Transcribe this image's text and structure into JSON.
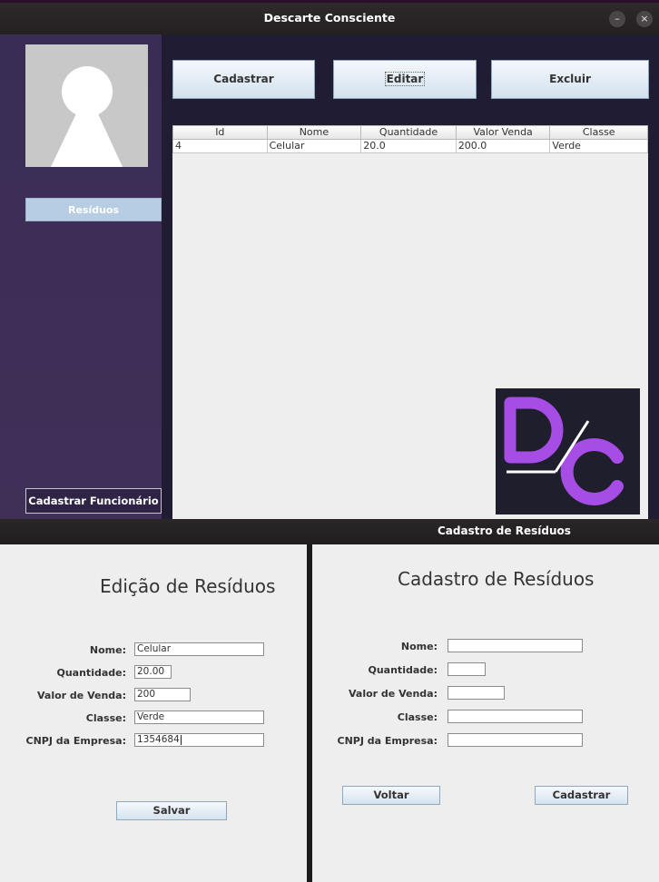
{
  "main_window": {
    "title": "Descarte Consciente",
    "min_glyph": "–",
    "close_glyph": "×",
    "sidebar": {
      "residuos_label": "Resíduos",
      "cadastrar_funcionario_label": "Cadastrar Funcionário"
    },
    "toolbar": {
      "cadastrar_label": "Cadastrar",
      "editar_label": "Editar",
      "excluir_label": "Excluir"
    },
    "table": {
      "columns": [
        "Id",
        "Nome",
        "Quantidade",
        "Valor Venda",
        "Classe"
      ],
      "rows": [
        [
          "4",
          "Celular",
          "20.0",
          "200.0",
          "Verde"
        ]
      ]
    },
    "logo": {
      "text": "D/C",
      "color": "#a64de6"
    }
  },
  "edit_panel": {
    "title": "Edição de Resíduos",
    "fields": {
      "nome": {
        "label": "Nome:",
        "value": "Celular"
      },
      "quantidade": {
        "label": "Quantidade:",
        "value": "20.00"
      },
      "valor_venda": {
        "label": "Valor de Venda:",
        "value": "200"
      },
      "classe": {
        "label": "Classe:",
        "value": "Verde"
      },
      "cnpj": {
        "label": "CNPJ da Empresa:",
        "value": "1354684"
      }
    },
    "salvar_label": "Salvar"
  },
  "cadastro_window": {
    "title": "Cadastro de Resíduos",
    "panel_title": "Cadastro de Resíduos",
    "fields": {
      "nome": {
        "label": "Nome:",
        "value": ""
      },
      "quantidade": {
        "label": "Quantidade:",
        "value": ""
      },
      "valor_venda": {
        "label": "Valor de Venda:",
        "value": ""
      },
      "classe": {
        "label": "Classe:",
        "value": ""
      },
      "cnpj": {
        "label": "CNPJ da Empresa:",
        "value": ""
      }
    },
    "voltar_label": "Voltar",
    "cadastrar_label": "Cadastrar"
  }
}
